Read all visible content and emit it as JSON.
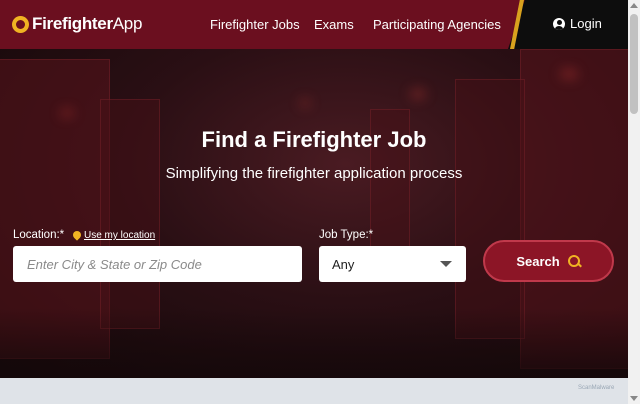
{
  "header": {
    "logo_bold": "Firefighter",
    "logo_light": "App",
    "nav": [
      "Firefighter Jobs",
      "Exams",
      "Participating Agencies"
    ],
    "login_label": "Login",
    "colors": {
      "header_bg": "#6b0f1f",
      "accent": "#d9a21e",
      "login_bg": "#0d0d0d"
    }
  },
  "hero": {
    "title": "Find a Firefighter Job",
    "subtitle": "Simplifying the firefighter application process"
  },
  "search": {
    "location_label": "Location:*",
    "use_location_label": "Use my location",
    "location_placeholder": "Enter City & State or Zip Code",
    "location_value": "",
    "job_type_label": "Job Type:*",
    "job_type_value": "Any",
    "search_button_label": "Search",
    "icons": {
      "pin": "map-pin-icon",
      "search": "search-icon",
      "dropdown": "chevron-down-icon",
      "login": "user-circle-icon"
    }
  },
  "footer": {
    "watermark": "ScanMalware"
  }
}
